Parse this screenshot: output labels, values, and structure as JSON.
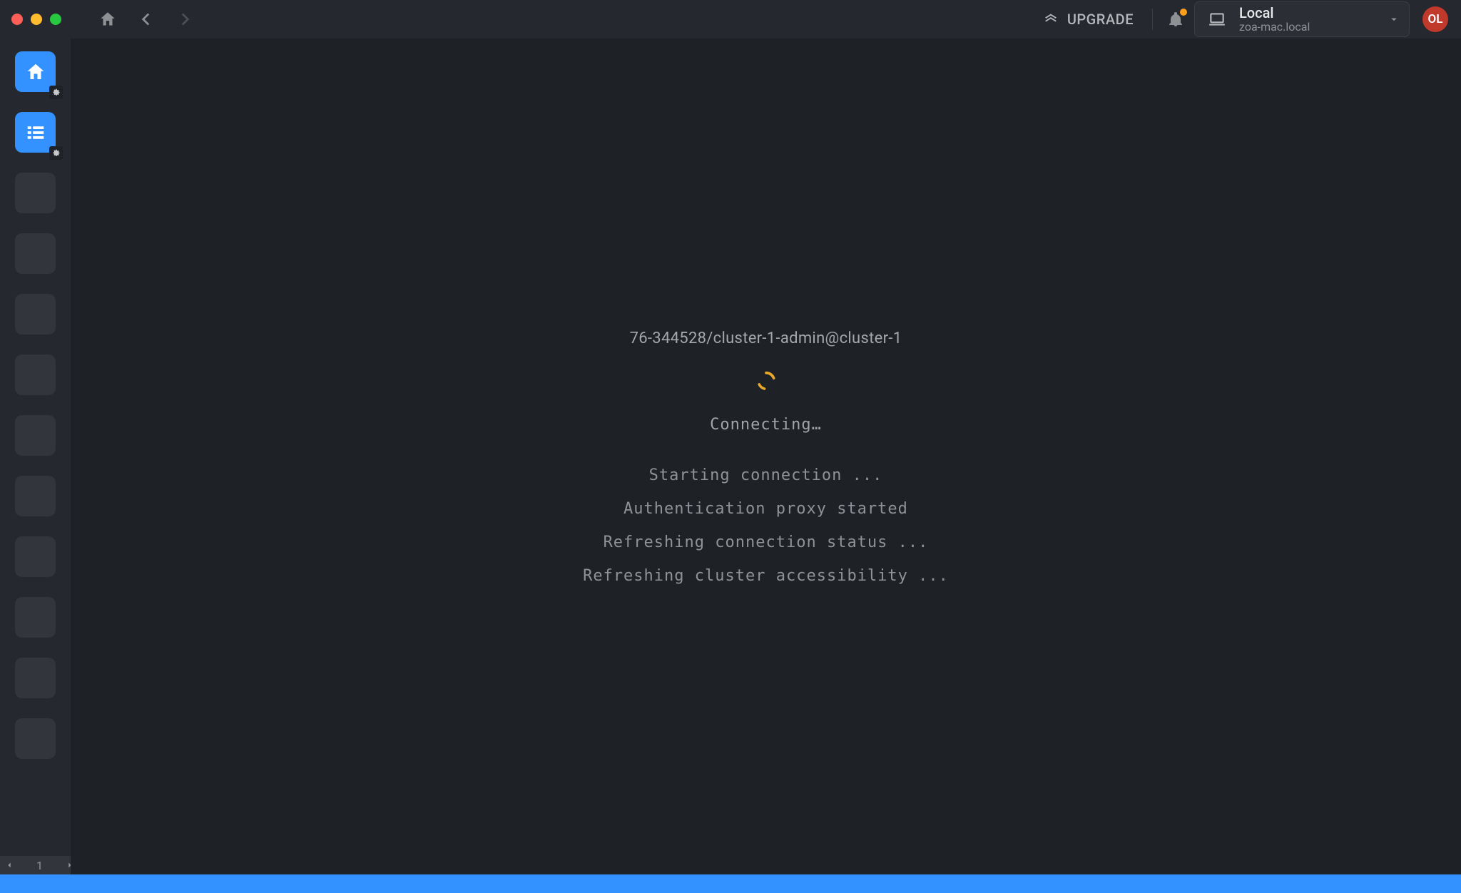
{
  "titlebar": {
    "upgrade_label": "UPGRADE",
    "host": {
      "title": "Local",
      "sub": "zoa-mac.local"
    },
    "avatar_initials": "OL"
  },
  "pager": {
    "page": "1"
  },
  "main": {
    "cluster": "76-344528/cluster-1-admin@cluster-1",
    "connecting": "Connecting…",
    "log": [
      "Starting connection ...",
      "Authentication proxy started",
      "Refreshing connection status ...",
      "Refreshing cluster accessibility ..."
    ]
  }
}
